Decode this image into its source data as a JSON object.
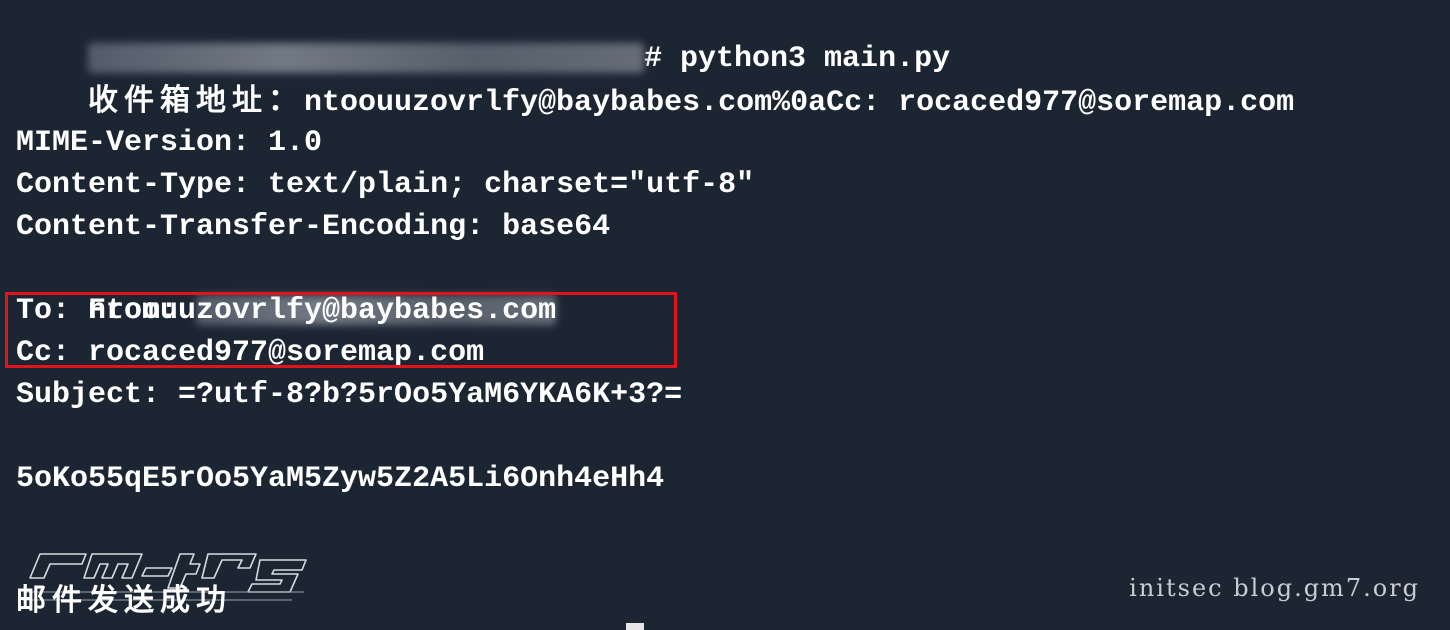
{
  "terminal": {
    "prompt_suffix": "# ",
    "command": "python3 main.py",
    "inbox_label": "收件箱地址：",
    "inbox_value": "ntoouuzovrlfy@baybabes.com%0aCc: rocaced977@soremap.com",
    "mime_version": "MIME-Version: 1.0",
    "content_type": "Content-Type: text/plain; charset=\"utf-8\"",
    "transfer_encoding": "Content-Transfer-Encoding: base64",
    "from_label": "From: ",
    "to_line": "To: ntoouuzovrlfy@baybabes.com",
    "cc_line": "Cc: rocaced977@soremap.com",
    "subject_line": "Subject: =?utf-8?b?5rOo5YaM6YKA6K+3?=",
    "body_line": "5oKo55qE5rOo5YaM5Zyw5Z2A5Li6Onh4eHh4",
    "success_message": "邮件发送成功"
  },
  "watermark": {
    "text": "initsec blog.gm7.org"
  },
  "colors": {
    "background": "#1c2633",
    "text": "#ffffff",
    "highlight_border": "#e1141c",
    "watermark": "#c9ccd1"
  }
}
